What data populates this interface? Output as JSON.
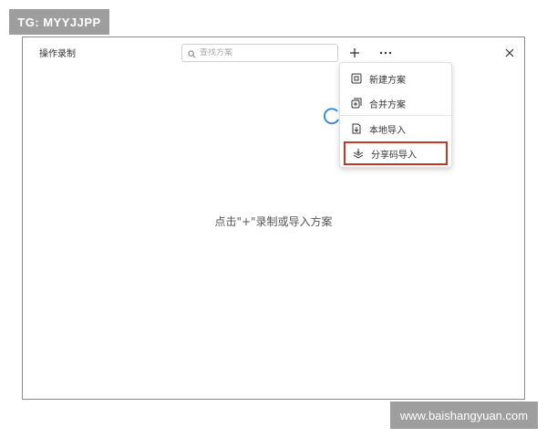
{
  "watermark": {
    "top": "TG: MYYJJPP",
    "bottom": "www.baishangyuan.com"
  },
  "window": {
    "title": "操作录制",
    "search": {
      "placeholder": "查找方案",
      "value": ""
    },
    "empty_hint": "点击\"+\"录制或导入方案"
  },
  "menu": {
    "items": [
      {
        "label": "新建方案",
        "icon": "new-plan-icon"
      },
      {
        "label": "合并方案",
        "icon": "merge-plan-icon"
      },
      {
        "label": "本地导入",
        "icon": "local-import-icon"
      },
      {
        "label": "分享码导入",
        "icon": "share-code-import-icon",
        "highlighted": true
      }
    ]
  },
  "colors": {
    "highlight_border": "#c0392b",
    "spinner": "#3a8fd6",
    "watermark_bg": "#9e9e9e"
  }
}
